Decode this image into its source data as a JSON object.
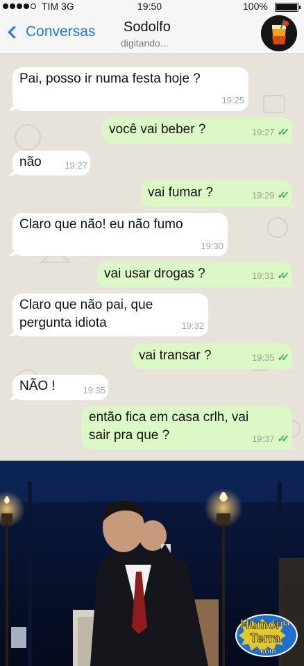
{
  "status_bar": {
    "carrier": "TIM 3G",
    "time": "19:50",
    "battery": "100%",
    "signal_bars": 4,
    "wifi_icon": "wifi-icon"
  },
  "header": {
    "back_label": "Conversas",
    "contact_name": "Sodolfo",
    "contact_status": "digitando...",
    "accent_color": "#1b7ae6"
  },
  "messages": [
    {
      "direction": "in",
      "lines": [
        "Pai, posso ir numa festa hoje ?"
      ],
      "time": "19:25"
    },
    {
      "direction": "out",
      "lines": [
        "você vai beber ?"
      ],
      "time": "19:27",
      "ticks": "read"
    },
    {
      "direction": "in",
      "lines": [
        "não"
      ],
      "time": "19:27"
    },
    {
      "direction": "out",
      "lines": [
        "vai fumar ?"
      ],
      "time": "19:29",
      "ticks": "read"
    },
    {
      "direction": "in",
      "lines": [
        "Claro que não! eu não fumo"
      ],
      "time": "19:30"
    },
    {
      "direction": "out",
      "lines": [
        "vai usar drogas ?"
      ],
      "time": "19:31",
      "ticks": "read"
    },
    {
      "direction": "in",
      "lines": [
        "Claro que não pai, que",
        "pergunta idiota"
      ],
      "time": "19:32"
    },
    {
      "direction": "out",
      "lines": [
        "vai transar ?"
      ],
      "time": "19:35",
      "ticks": "read"
    },
    {
      "direction": "in",
      "lines": [
        "NÃO !"
      ],
      "time": "19:35"
    },
    {
      "direction": "out",
      "lines": [
        "então fica em casa crlh, vai",
        "sair pra que ?"
      ],
      "time": "19:37",
      "ticks": "read"
    }
  ],
  "colors": {
    "incoming_bubble": "#ffffff",
    "outgoing_bubble": "#dcf8c6",
    "chat_background": "#e7e2da",
    "read_ticks": "#3fb34f"
  },
  "watermark": {
    "line1": "Humor",
    "line2": "da",
    "line3": "Terra",
    "line4": ".com"
  }
}
